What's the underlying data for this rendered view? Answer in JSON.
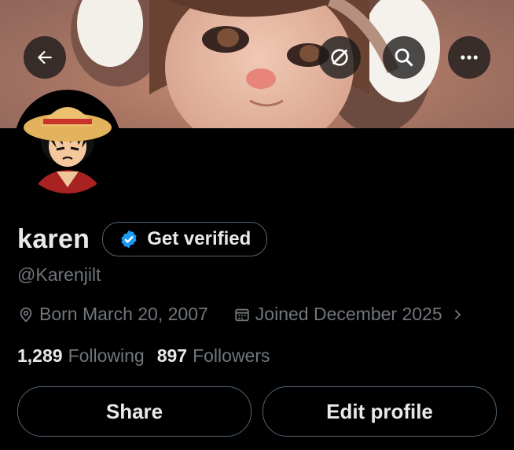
{
  "profile": {
    "name": "karen",
    "handle": "@Karenjilt",
    "verify_label": "Get verified",
    "born": "Born March 20, 2007",
    "joined": "Joined December 2025",
    "following_count": "1,289",
    "following_label": "Following",
    "followers_count": "897",
    "followers_label": "Followers"
  },
  "actions": {
    "share_label": "Share",
    "edit_label": "Edit profile"
  },
  "icons": {
    "back": "arrow-left-icon",
    "grok": "grok-icon",
    "search": "search-icon",
    "more": "more-icon",
    "verified": "verified-badge-icon",
    "location": "location-pin-icon",
    "calendar": "calendar-icon",
    "chevron": "chevron-right-icon"
  },
  "colors": {
    "background": "#000000",
    "text_primary": "#e7e9ea",
    "text_secondary": "#71767b",
    "border": "#536471",
    "verified_blue": "#1d9bf0"
  }
}
